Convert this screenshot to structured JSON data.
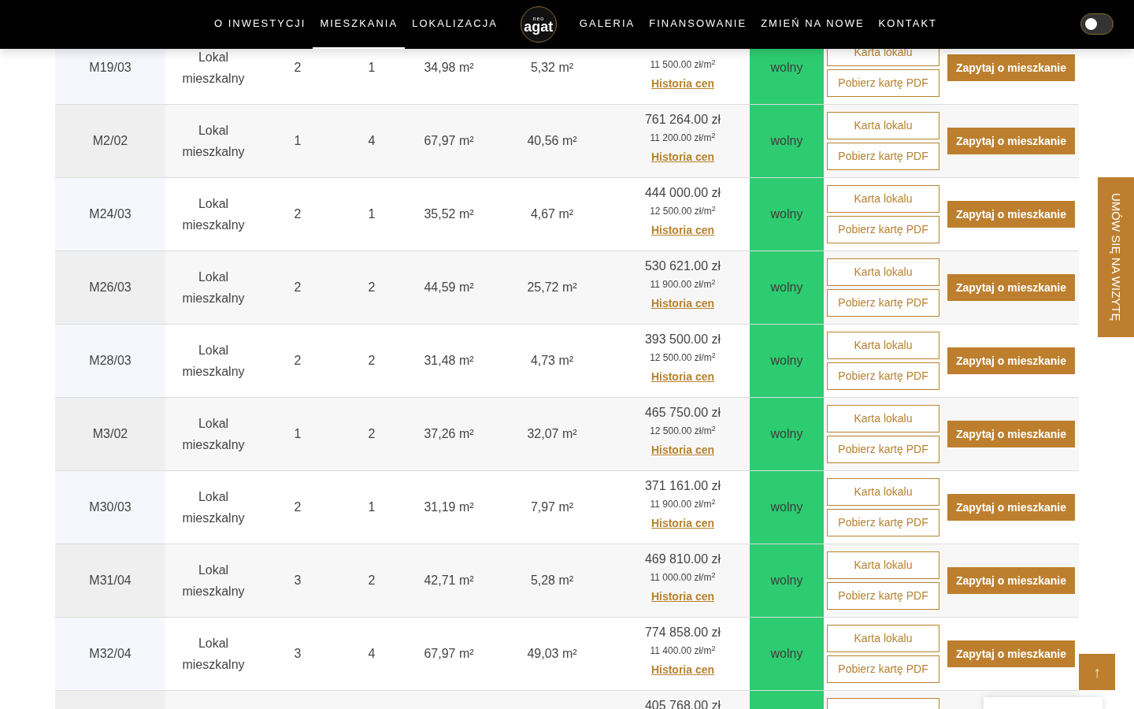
{
  "nav": {
    "left": [
      {
        "label": "O INWESTYCJI",
        "selected": false
      },
      {
        "label": "MIESZKANIA",
        "selected": true
      },
      {
        "label": "LOKALIZACJA",
        "selected": false
      }
    ],
    "logo": {
      "small": "neo",
      "main": "agat"
    },
    "right": [
      {
        "label": "GALERIA",
        "selected": false
      },
      {
        "label": "FINANSOWANIE",
        "selected": false
      },
      {
        "label": "ZMIEŃ NA NOWE",
        "selected": false
      },
      {
        "label": "KONTAKT",
        "selected": false
      }
    ],
    "theme_toggle": {
      "on": false
    }
  },
  "rows": [
    {
      "id": "M19/03",
      "type": "Lokal mieszkalny",
      "rooms": "2",
      "floor": "1",
      "area": "34,98 m²",
      "extra_area": "5,32 m²",
      "price_m2": "11 500.00 zł/m$^{2}$",
      "history": "Historia cen",
      "status": "wolny",
      "card": "Karta lokalu",
      "pdf": "Pobierz kartę PDF",
      "ask": "Zapytaj o mieszkanie"
    },
    {
      "id": "M2/02",
      "type": "Lokal mieszkalny",
      "rooms": "1",
      "floor": "4",
      "area": "67,97 m²",
      "extra_area": "40,56 m²",
      "price": "761 264.00 zł",
      "price_m2": "11 200.00 zł/m$^{2}$",
      "history": "Historia cen",
      "status": "wolny",
      "card": "Karta lokalu",
      "pdf": "Pobierz kartę PDF",
      "ask": "Zapytaj o mieszkanie"
    },
    {
      "id": "M24/03",
      "type": "Lokal mieszkalny",
      "rooms": "2",
      "floor": "1",
      "area": "35,52 m²",
      "extra_area": "4,67 m²",
      "price": "444 000.00 zł",
      "price_m2": "12 500.00 zł/m$^{2}$",
      "history": "Historia cen",
      "status": "wolny",
      "card": "Karta lokalu",
      "pdf": "Pobierz kartę PDF",
      "ask": "Zapytaj o mieszkanie"
    },
    {
      "id": "M26/03",
      "type": "Lokal mieszkalny",
      "rooms": "2",
      "floor": "2",
      "area": "44,59 m²",
      "extra_area": "25,72 m²",
      "price": "530 621.00 zł",
      "price_m2": "11 900.00 zł/m$^{2}$",
      "history": "Historia cen",
      "status": "wolny",
      "card": "Karta lokalu",
      "pdf": "Pobierz kartę PDF",
      "ask": "Zapytaj o mieszkanie"
    },
    {
      "id": "M28/03",
      "type": "Lokal mieszkalny",
      "rooms": "2",
      "floor": "2",
      "area": "31,48 m²",
      "extra_area": "4,73 m²",
      "price": "393 500.00 zł",
      "price_m2": "12 500.00 zł/m$^{2}$",
      "history": "Historia cen",
      "status": "wolny",
      "card": "Karta lokalu",
      "pdf": "Pobierz kartę PDF",
      "ask": "Zapytaj o mieszkanie"
    },
    {
      "id": "M3/02",
      "type": "Lokal mieszkalny",
      "rooms": "1",
      "floor": "2",
      "area": "37,26 m²",
      "extra_area": "32,07 m²",
      "price": "465 750.00 zł",
      "price_m2": "12 500.00 zł/m$^{2}$",
      "history": "Historia cen",
      "status": "wolny",
      "card": "Karta lokalu",
      "pdf": "Pobierz kartę PDF",
      "ask": "Zapytaj o mieszkanie"
    },
    {
      "id": "M30/03",
      "type": "Lokal mieszkalny",
      "rooms": "2",
      "floor": "1",
      "area": "31,19 m²",
      "extra_area": "7,97 m²",
      "price": "371 161.00 zł",
      "price_m2": "11 900.00 zł/m$^{2}$",
      "history": "Historia cen",
      "status": "wolny",
      "card": "Karta lokalu",
      "pdf": "Pobierz kartę PDF",
      "ask": "Zapytaj o mieszkanie"
    },
    {
      "id": "M31/04",
      "type": "Lokal mieszkalny",
      "rooms": "3",
      "floor": "2",
      "area": "42,71 m²",
      "extra_area": "5,28 m²",
      "price": "469 810.00 zł",
      "price_m2": "11 000.00 zł/m$^{2}$",
      "history": "Historia cen",
      "status": "wolny",
      "card": "Karta lokalu",
      "pdf": "Pobierz kartę PDF",
      "ask": "Zapytaj o mieszkanie"
    },
    {
      "id": "M32/04",
      "type": "Lokal mieszkalny",
      "rooms": "3",
      "floor": "4",
      "area": "67,97 m²",
      "extra_area": "49,03 m²",
      "price": "774 858.00 zł",
      "price_m2": "11 400.00 zł/m$^{2}$",
      "history": "Historia cen",
      "status": "wolny",
      "card": "Karta lokalu",
      "pdf": "Pobierz kartę PDF",
      "ask": "Zapytaj o mieszkanie"
    },
    {
      "price": "405 768.00 zł"
    }
  ],
  "visit_tab": "UMÓW SIĘ NA WIZYTĘ",
  "scroll_top": "↑"
}
